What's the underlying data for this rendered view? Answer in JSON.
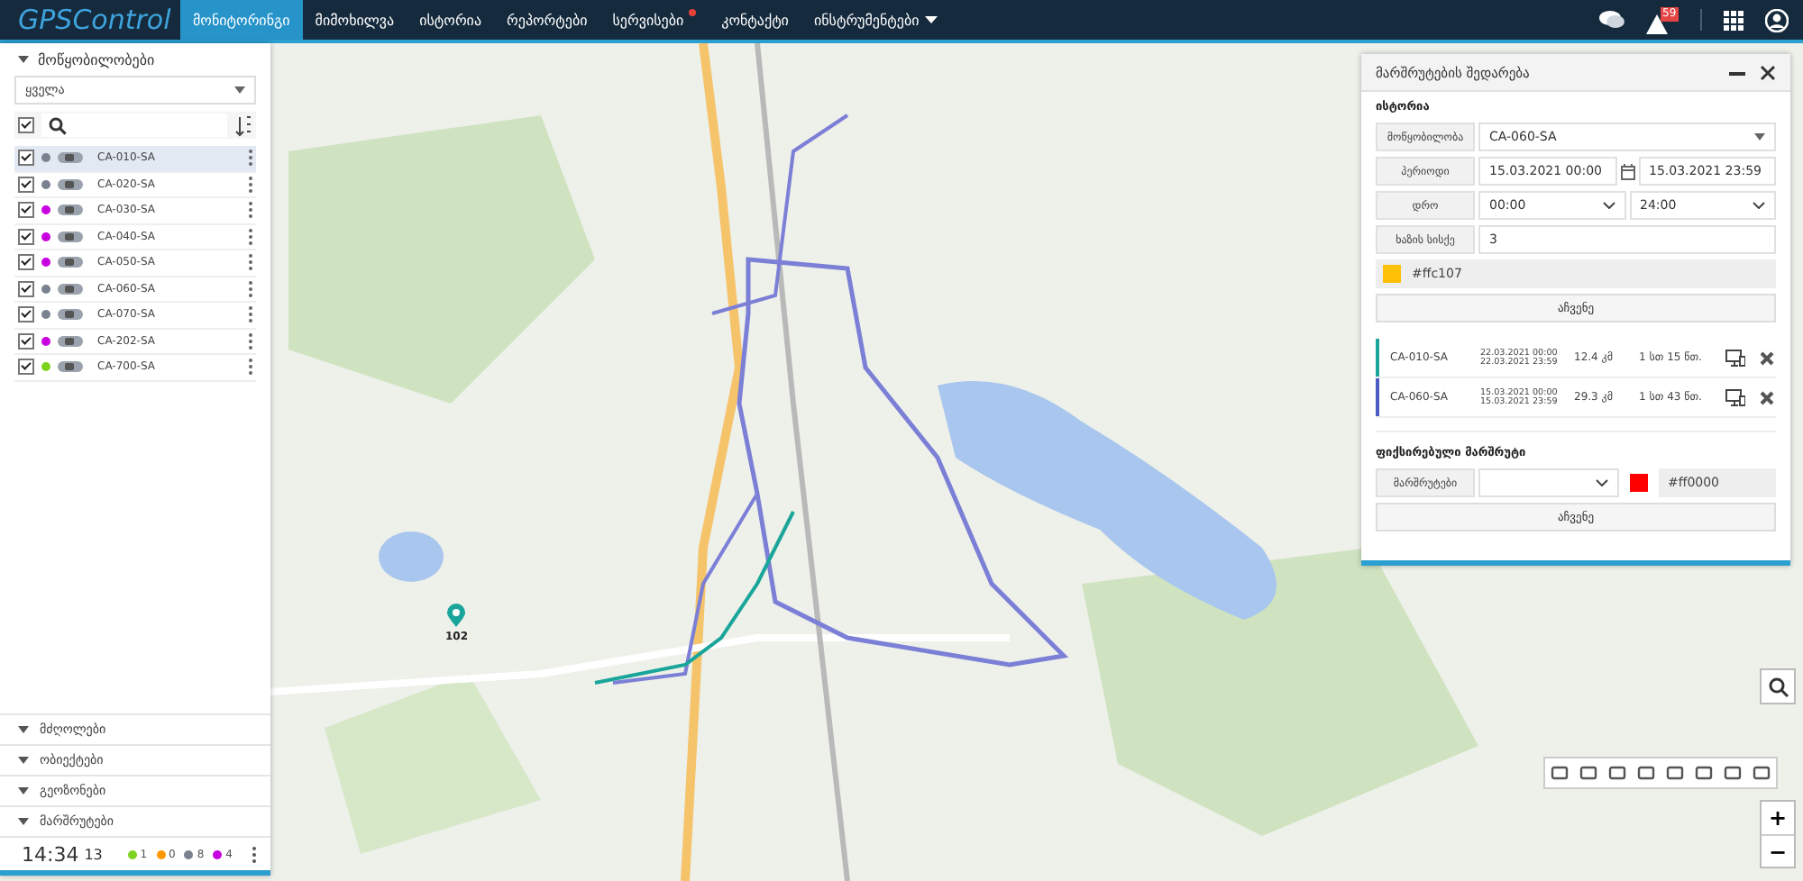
{
  "navbar": {
    "logo": "GPSControl",
    "items": [
      {
        "label": "მონიტორინგი",
        "selected": true,
        "dot": false,
        "caret": false
      },
      {
        "label": "მიმოხილვა",
        "selected": false,
        "dot": false,
        "caret": false
      },
      {
        "label": "ისტორია",
        "selected": false,
        "dot": false,
        "caret": false
      },
      {
        "label": "რეპორტები",
        "selected": false,
        "dot": false,
        "caret": false
      },
      {
        "label": "სერვისები",
        "selected": false,
        "dot": true,
        "caret": false
      },
      {
        "label": "კონტაქტი",
        "selected": false,
        "dot": false,
        "caret": false
      },
      {
        "label": "ინსტრუმენტები",
        "selected": false,
        "dot": false,
        "caret": true
      }
    ],
    "alert_badge": "59"
  },
  "devices_panel": {
    "title": "მოწყობილობები",
    "filter": "ყველა",
    "select_all": true,
    "devices": [
      {
        "name": "CA-010-SA",
        "checked": true,
        "selected": true,
        "color": "#7a8290"
      },
      {
        "name": "CA-020-SA",
        "checked": true,
        "selected": false,
        "color": "#7a8290"
      },
      {
        "name": "CA-030-SA",
        "checked": true,
        "selected": false,
        "color": "#c800e0"
      },
      {
        "name": "CA-040-SA",
        "checked": true,
        "selected": false,
        "color": "#c800e0"
      },
      {
        "name": "CA-050-SA",
        "checked": true,
        "selected": false,
        "color": "#c800e0"
      },
      {
        "name": "CA-060-SA",
        "checked": true,
        "selected": false,
        "color": "#7a8290"
      },
      {
        "name": "CA-070-SA",
        "checked": true,
        "selected": false,
        "color": "#7a8290"
      },
      {
        "name": "CA-202-SA",
        "checked": true,
        "selected": false,
        "color": "#c800e0"
      },
      {
        "name": "CA-700-SA",
        "checked": true,
        "selected": false,
        "color": "#7ed321"
      }
    ],
    "sections": [
      "მძღოლები",
      "ობიექტები",
      "გეოზონები",
      "მარშრუტები"
    ],
    "clock": {
      "time": "14:34",
      "seconds": "13"
    },
    "counts": [
      {
        "value": "1",
        "color": "#7ed321"
      },
      {
        "value": "0",
        "color": "#ff9800"
      },
      {
        "value": "8",
        "color": "#7a8290"
      },
      {
        "value": "4",
        "color": "#c800e0"
      }
    ]
  },
  "route_panel": {
    "title": "მარშრუტების შედარება",
    "section": "ისტორია",
    "device_label": "მოწყობილობა",
    "device_value": "CA-060-SA",
    "period_label": "პერიოდი",
    "period_from": "15.03.2021 00:00",
    "period_to": "15.03.2021 23:59",
    "time_label": "დრო",
    "time_from": "00:00",
    "time_to": "24:00",
    "width_label": "ხაზის სისქე",
    "width_value": "3",
    "line_color": "#ffc107",
    "show_button": "აჩვენე",
    "routes": [
      {
        "device": "CA-010-SA",
        "from": "22.03.2021 00:00",
        "to": "22.03.2021 23:59",
        "distance": "12.4 კმ",
        "duration": "1 სთ 15 წთ.",
        "color": "#1aa59a"
      },
      {
        "device": "CA-060-SA",
        "from": "15.03.2021 00:00",
        "to": "15.03.2021 23:59",
        "distance": "29.3 კმ",
        "duration": "1 სთ 43 წთ.",
        "color": "#4a5bc4"
      }
    ],
    "fixed_title": "ფიქსირებული მარშრუტი",
    "fixed_label": "მარშრუტები",
    "fixed_color": "#ff0000",
    "fixed_button": "აჩვენე"
  },
  "map": {
    "zoom_in": "+",
    "zoom_out": "−",
    "marker_label": "102"
  }
}
